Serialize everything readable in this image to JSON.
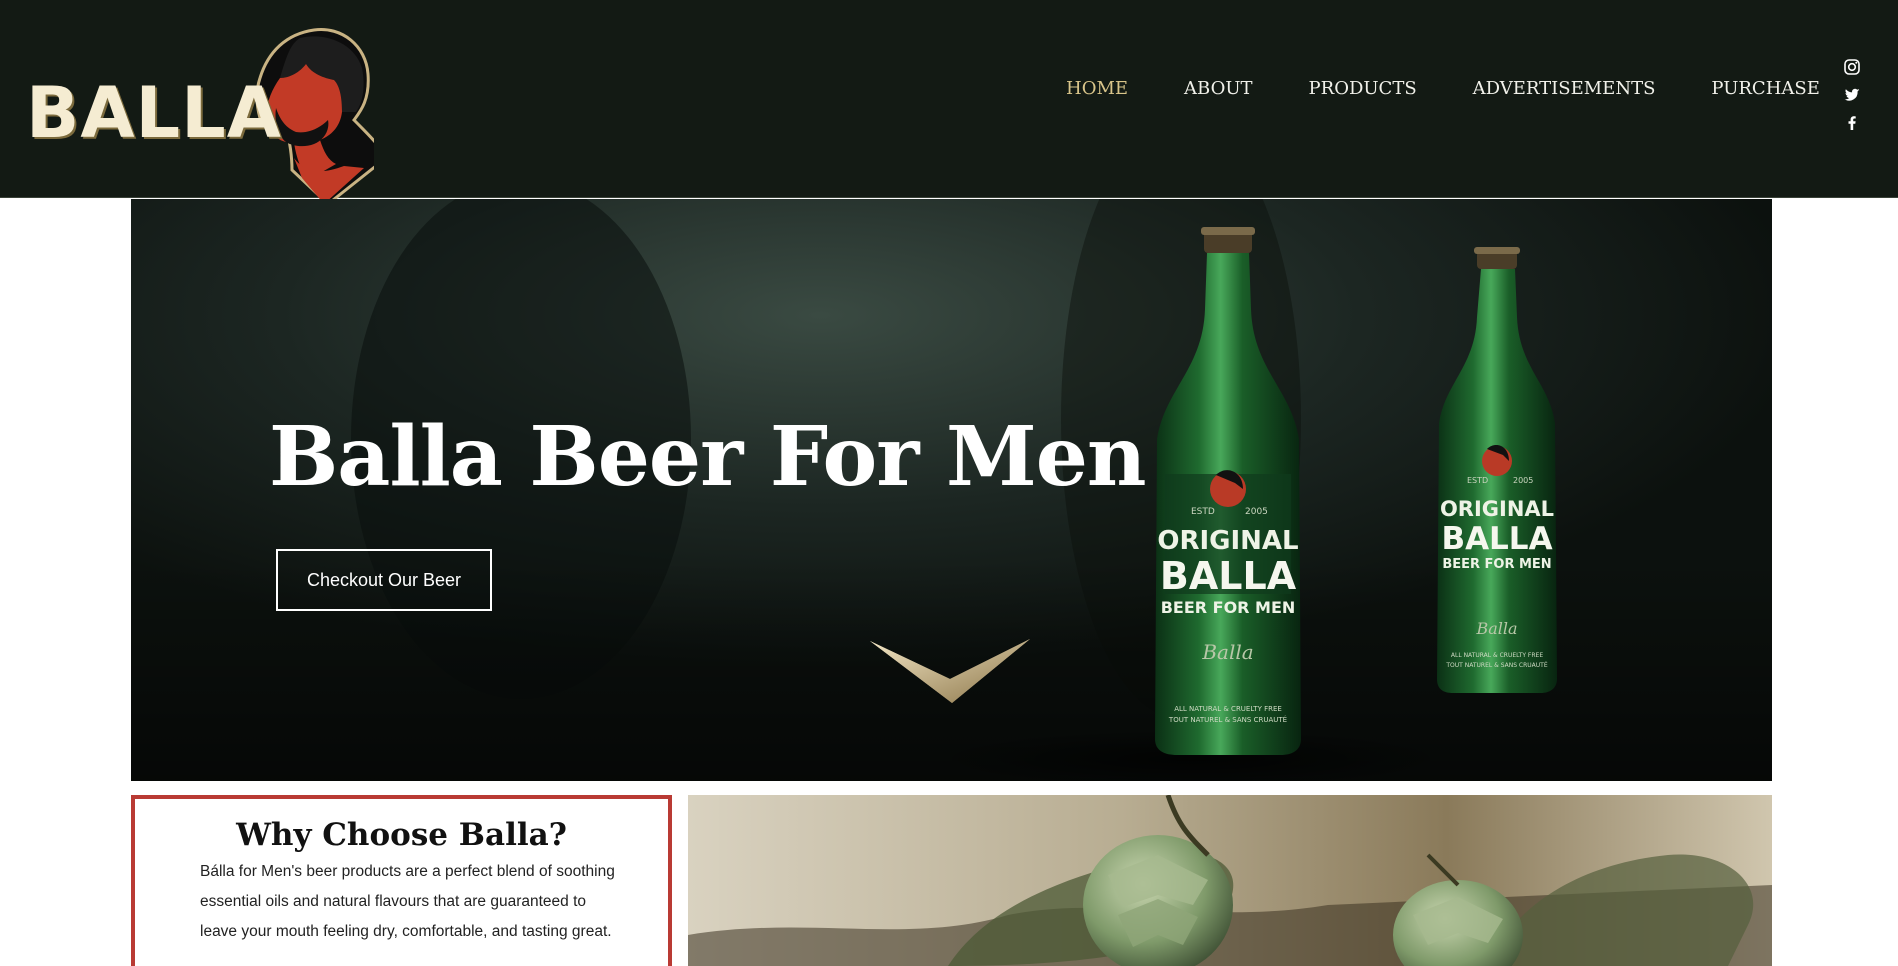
{
  "brand": {
    "logo_text": "BALLA",
    "colors": {
      "header_bg": "#131a14",
      "accent_red": "#b93a34",
      "nav_active": "#d9c58a"
    }
  },
  "nav": {
    "items": [
      {
        "label": "HOME",
        "active": true
      },
      {
        "label": "ABOUT",
        "active": false
      },
      {
        "label": "PRODUCTS",
        "active": false
      },
      {
        "label": "ADVERTISEMENTS",
        "active": false
      },
      {
        "label": "PURCHASE",
        "active": false
      }
    ]
  },
  "social": {
    "icons": [
      "instagram-icon",
      "twitter-icon",
      "facebook-icon"
    ]
  },
  "hero": {
    "title": "Balla Beer For Men",
    "button_label": "Checkout Our Beer",
    "bottle_label": {
      "line1": "ORIGINAL",
      "line2": "BALLA",
      "line3": "BEER FOR MEN",
      "estd": "ESTD",
      "year": "2005",
      "fine1": "ALL NATURAL & CRUELTY FREE",
      "fine2": "TOUT NATUREL & SANS CRUAUTÉ",
      "signature": "Balla"
    }
  },
  "why": {
    "title": "Why Choose Balla?",
    "body": "Bálla for Men's beer products are a perfect blend of soothing essential oils and natural flavours that are guaranteed to leave your mouth feeling dry, comfortable, and tasting great."
  }
}
